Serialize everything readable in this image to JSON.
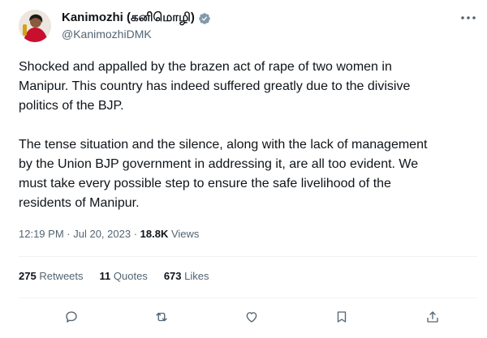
{
  "author": {
    "display_name": "Kanimozhi (கனிமொழி)",
    "handle": "@KanimozhiDMK"
  },
  "tweet": {
    "paragraphs": [
      "Shocked and appalled by the brazen act of rape of two women in\nManipur. This country has indeed suffered greatly due to the divisive\npolitics of the BJP.",
      "The tense situation and the silence, along with the lack of management\nby the Union BJP government in addressing it, are all too evident. We\nmust take every possible step to ensure the safe livelihood of the\nresidents of Manipur."
    ],
    "time": "12:19 PM",
    "date": "Jul 20, 2023",
    "views_count": "18.8K",
    "views_label": "Views"
  },
  "stats": {
    "retweets_count": "275",
    "retweets_label": "Retweets",
    "quotes_count": "11",
    "quotes_label": "Quotes",
    "likes_count": "673",
    "likes_label": "Likes"
  },
  "icons": {
    "verified": "verified-badge-icon",
    "more": "more-options-icon",
    "reply": "reply-icon",
    "retweet": "retweet-icon",
    "like": "like-icon",
    "bookmark": "bookmark-icon",
    "share": "share-icon"
  },
  "colors": {
    "verified": "#829aab",
    "secondary_text": "#536471",
    "primary_text": "#0f1419",
    "divider": "#eff3f4"
  }
}
